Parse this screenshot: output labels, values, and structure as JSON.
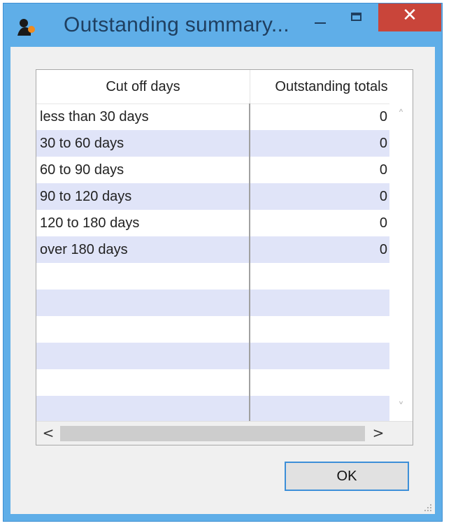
{
  "window": {
    "title": "Outstanding summary...",
    "close_glyph": "✕",
    "colors": {
      "frame": "#5faee8",
      "close": "#c9453a",
      "row_alt": "#e0e4f8"
    }
  },
  "grid": {
    "columns": [
      "Cut off days",
      "Outstanding totals"
    ],
    "rows": [
      {
        "cut_off": "less than 30 days",
        "total": "0"
      },
      {
        "cut_off": "30 to 60 days",
        "total": "0"
      },
      {
        "cut_off": "60 to 90 days",
        "total": "0"
      },
      {
        "cut_off": "90 to 120 days",
        "total": "0"
      },
      {
        "cut_off": "120 to 180 days",
        "total": "0"
      },
      {
        "cut_off": "over 180 days",
        "total": "0"
      },
      {
        "cut_off": "",
        "total": ""
      },
      {
        "cut_off": "",
        "total": ""
      },
      {
        "cut_off": "",
        "total": ""
      },
      {
        "cut_off": "",
        "total": ""
      },
      {
        "cut_off": "",
        "total": ""
      },
      {
        "cut_off": "",
        "total": ""
      }
    ],
    "scroll_glyphs": {
      "up": "˄",
      "down": "˅",
      "left": "<",
      "right": ">"
    }
  },
  "buttons": {
    "ok": "OK"
  },
  "icons": [
    "app-icon",
    "minimize-icon",
    "maximize-icon",
    "close-icon",
    "resize-grip-icon"
  ]
}
